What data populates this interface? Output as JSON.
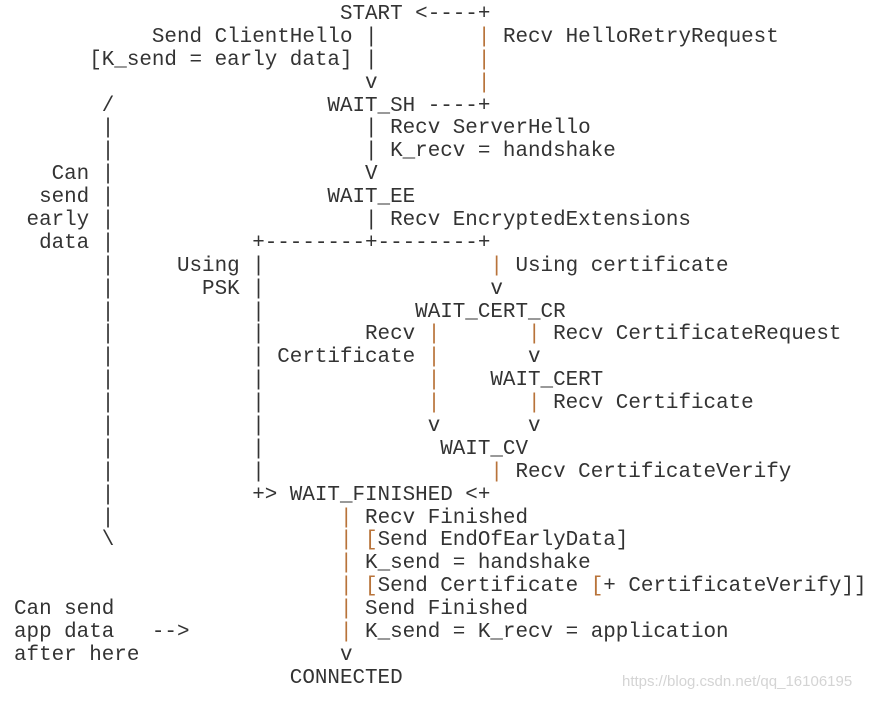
{
  "diagram": {
    "lines": [
      "                          START <----+",
      "           Send ClientHello |        | Recv HelloRetryRequest",
      "      [K_send = early data] |        |",
      "                            v        |",
      "       /                 WAIT_SH ----+",
      "       |                    | Recv ServerHello",
      "       |                    | K_recv = handshake",
      "   Can |                    V",
      "  send |                 WAIT_EE",
      " early |                    | Recv EncryptedExtensions",
      "  data |           +--------+--------+",
      "       |     Using |                  | Using certificate",
      "       |       PSK |                  v",
      "       |           |            WAIT_CERT_CR",
      "       |           |        Recv |       | Recv CertificateRequest",
      "       |           | Certificate |       v",
      "       |           |             |    WAIT_CERT",
      "       |           |             |       | Recv Certificate",
      "       |           |             v       v",
      "       |           |              WAIT_CV",
      "       |           |                  | Recv CertificateVerify",
      "       |           +> WAIT_FINISHED <+",
      "       |                  | Recv Finished",
      "       \\                  | [Send EndOfEarlyData]",
      "                          | K_send = handshake",
      "                          | [Send Certificate [+ CertificateVerify]]",
      "Can send                  | Send Finished",
      "app data   -->            | K_send = K_recv = application",
      "after here                v",
      "                      CONNECTED"
    ]
  },
  "watermark": "https://blog.csdn.net/qq_16106195",
  "colors": {
    "text": "#333333",
    "highlight": "#b8733a",
    "watermark": "#d4d4d4"
  }
}
